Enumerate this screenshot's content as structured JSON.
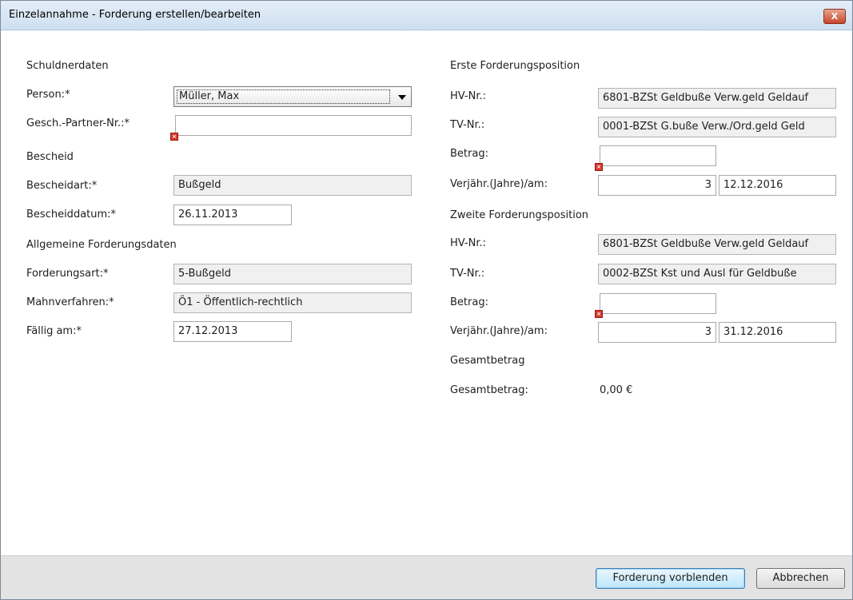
{
  "window": {
    "title": "Einzelannahme - Forderung erstellen/bearbeiten",
    "close_label": "X"
  },
  "left": {
    "section_debtor": "Schuldnerdaten",
    "person_label": "Person:*",
    "person_value": "Müller, Max",
    "partner_label": "Gesch.-Partner-Nr.:*",
    "partner_value": "",
    "section_notice": "Bescheid",
    "notice_type_label": "Bescheidart:*",
    "notice_type_value": "Bußgeld",
    "notice_date_label": "Bescheiddatum:*",
    "notice_date_value": "26.11.2013",
    "section_general": "Allgemeine Forderungsdaten",
    "claim_type_label": "Forderungsart:*",
    "claim_type_value": "5-Bußgeld",
    "dunning_label": "Mahnverfahren:*",
    "dunning_value": "Ö1 - Öffentlich-rechtlich",
    "due_label": "Fällig am:*",
    "due_value": "27.12.2013"
  },
  "right": {
    "first": {
      "section": "Erste Forderungsposition",
      "hv_label": "HV-Nr.:",
      "hv_value": "6801-BZSt Geldbuße Verw.geld Geldauf",
      "tv_label": "TV-Nr.:",
      "tv_value": "0001-BZSt G.buße Verw./Ord.geld Geld",
      "amount_label": "Betrag:",
      "amount_value": "",
      "limit_label": "Verjähr.(Jahre)/am:",
      "limit_years": "3",
      "limit_date": "12.12.2016"
    },
    "second": {
      "section": "Zweite Forderungsposition",
      "hv_label": "HV-Nr.:",
      "hv_value": "6801-BZSt Geldbuße Verw.geld Geldauf",
      "tv_label": "TV-Nr.:",
      "tv_value": "0002-BZSt Kst und Ausl für Geldbuße",
      "amount_label": "Betrag:",
      "amount_value": "",
      "limit_label": "Verjähr.(Jahre)/am:",
      "limit_years": "3",
      "limit_date": "31.12.2016"
    },
    "total": {
      "section": "Gesamtbetrag",
      "label": "Gesamtbetrag:",
      "value": "0,00 €"
    }
  },
  "footer": {
    "preview_button": "Forderung vorblenden",
    "cancel_button": "Abbrechen"
  }
}
